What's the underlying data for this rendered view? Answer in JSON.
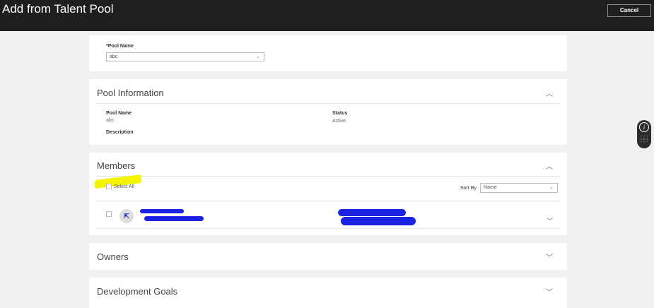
{
  "header": {
    "title": "Add from Talent Pool",
    "cancel_label": "Cancel"
  },
  "pool_select": {
    "label": "*Pool Name",
    "value": "abc"
  },
  "pool_information": {
    "title": "Pool Information",
    "pool_name_label": "Pool Name",
    "pool_name_value": "abc",
    "status_label": "Status",
    "status_value": "Active",
    "description_label": "Description"
  },
  "members": {
    "title": "Members",
    "select_all_label": "Select All",
    "sort_by_label": "Sort By",
    "sort_by_value": "Name"
  },
  "owners": {
    "title": "Owners"
  },
  "development_goals": {
    "title": "Development Goals"
  },
  "colors": {
    "header": "#1e1e1e",
    "highlight": "#f5f500",
    "redaction": "#1b22e0"
  }
}
